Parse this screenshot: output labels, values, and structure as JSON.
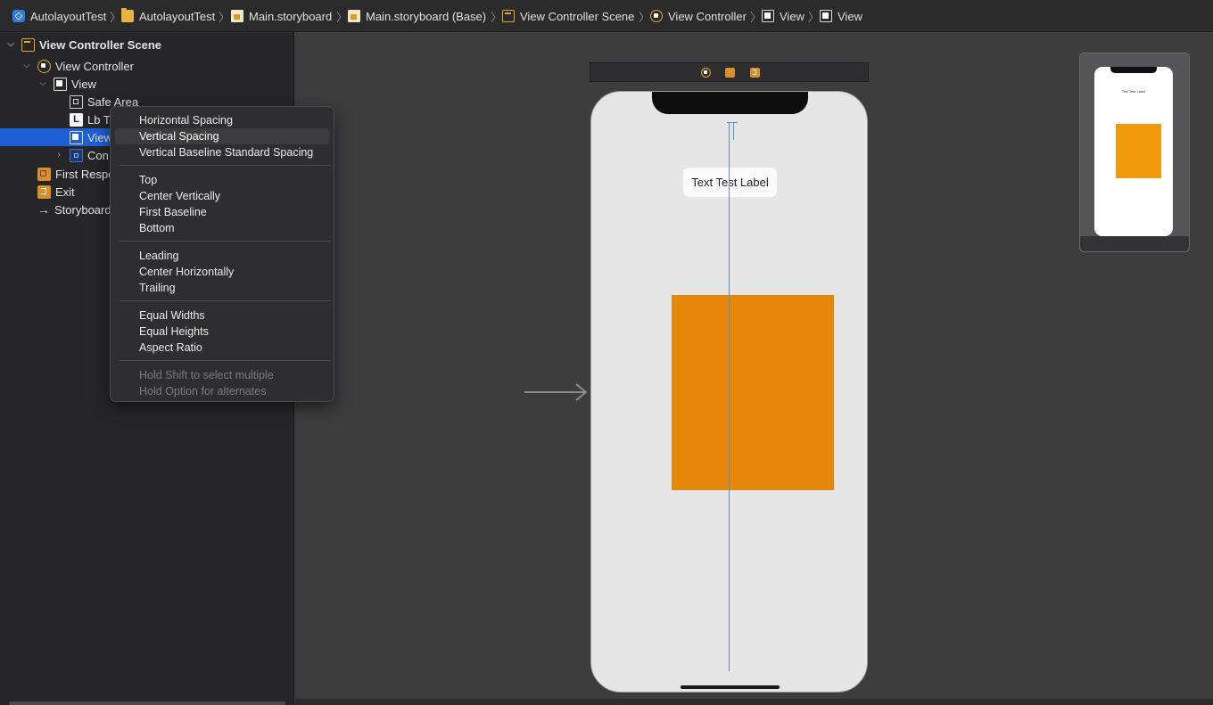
{
  "breadcrumb": [
    {
      "label": "AutolayoutTest",
      "icon": "app-icon"
    },
    {
      "label": "AutolayoutTest",
      "icon": "folder-icon"
    },
    {
      "label": "Main.storyboard",
      "icon": "storyboard-file-icon"
    },
    {
      "label": "Main.storyboard (Base)",
      "icon": "storyboard-file-icon"
    },
    {
      "label": "View Controller Scene",
      "icon": "scene-icon"
    },
    {
      "label": "View Controller",
      "icon": "view-controller-icon"
    },
    {
      "label": "View",
      "icon": "view-icon"
    },
    {
      "label": "View",
      "icon": "view-icon"
    }
  ],
  "outline": {
    "scene": "View Controller Scene",
    "view_controller": "View Controller",
    "view": "View",
    "safe_area": "Safe Area",
    "label_item": "Lb T",
    "selected_view": "View",
    "constraints": "Con",
    "first_responder": "First Respo",
    "exit": "Exit",
    "storyboard_entry": "Storyboard"
  },
  "context_menu": {
    "group1": [
      "Horizontal Spacing",
      "Vertical Spacing",
      "Vertical Baseline Standard Spacing"
    ],
    "group2": [
      "Top",
      "Center Vertically",
      "First Baseline",
      "Bottom"
    ],
    "group3": [
      "Leading",
      "Center Horizontally",
      "Trailing"
    ],
    "group4": [
      "Equal Widths",
      "Equal Heights",
      "Aspect Ratio"
    ],
    "hints": [
      "Hold Shift to select multiple",
      "Hold Option for alternates"
    ],
    "highlighted": "Vertical Spacing"
  },
  "canvas": {
    "label_text": "Text Test Label",
    "minimap_label_text": "Text Test Label"
  },
  "colors": {
    "accent_selection": "#1f5fd4",
    "orange_view": "#e5870a",
    "guide_line": "#5b8ed4"
  }
}
